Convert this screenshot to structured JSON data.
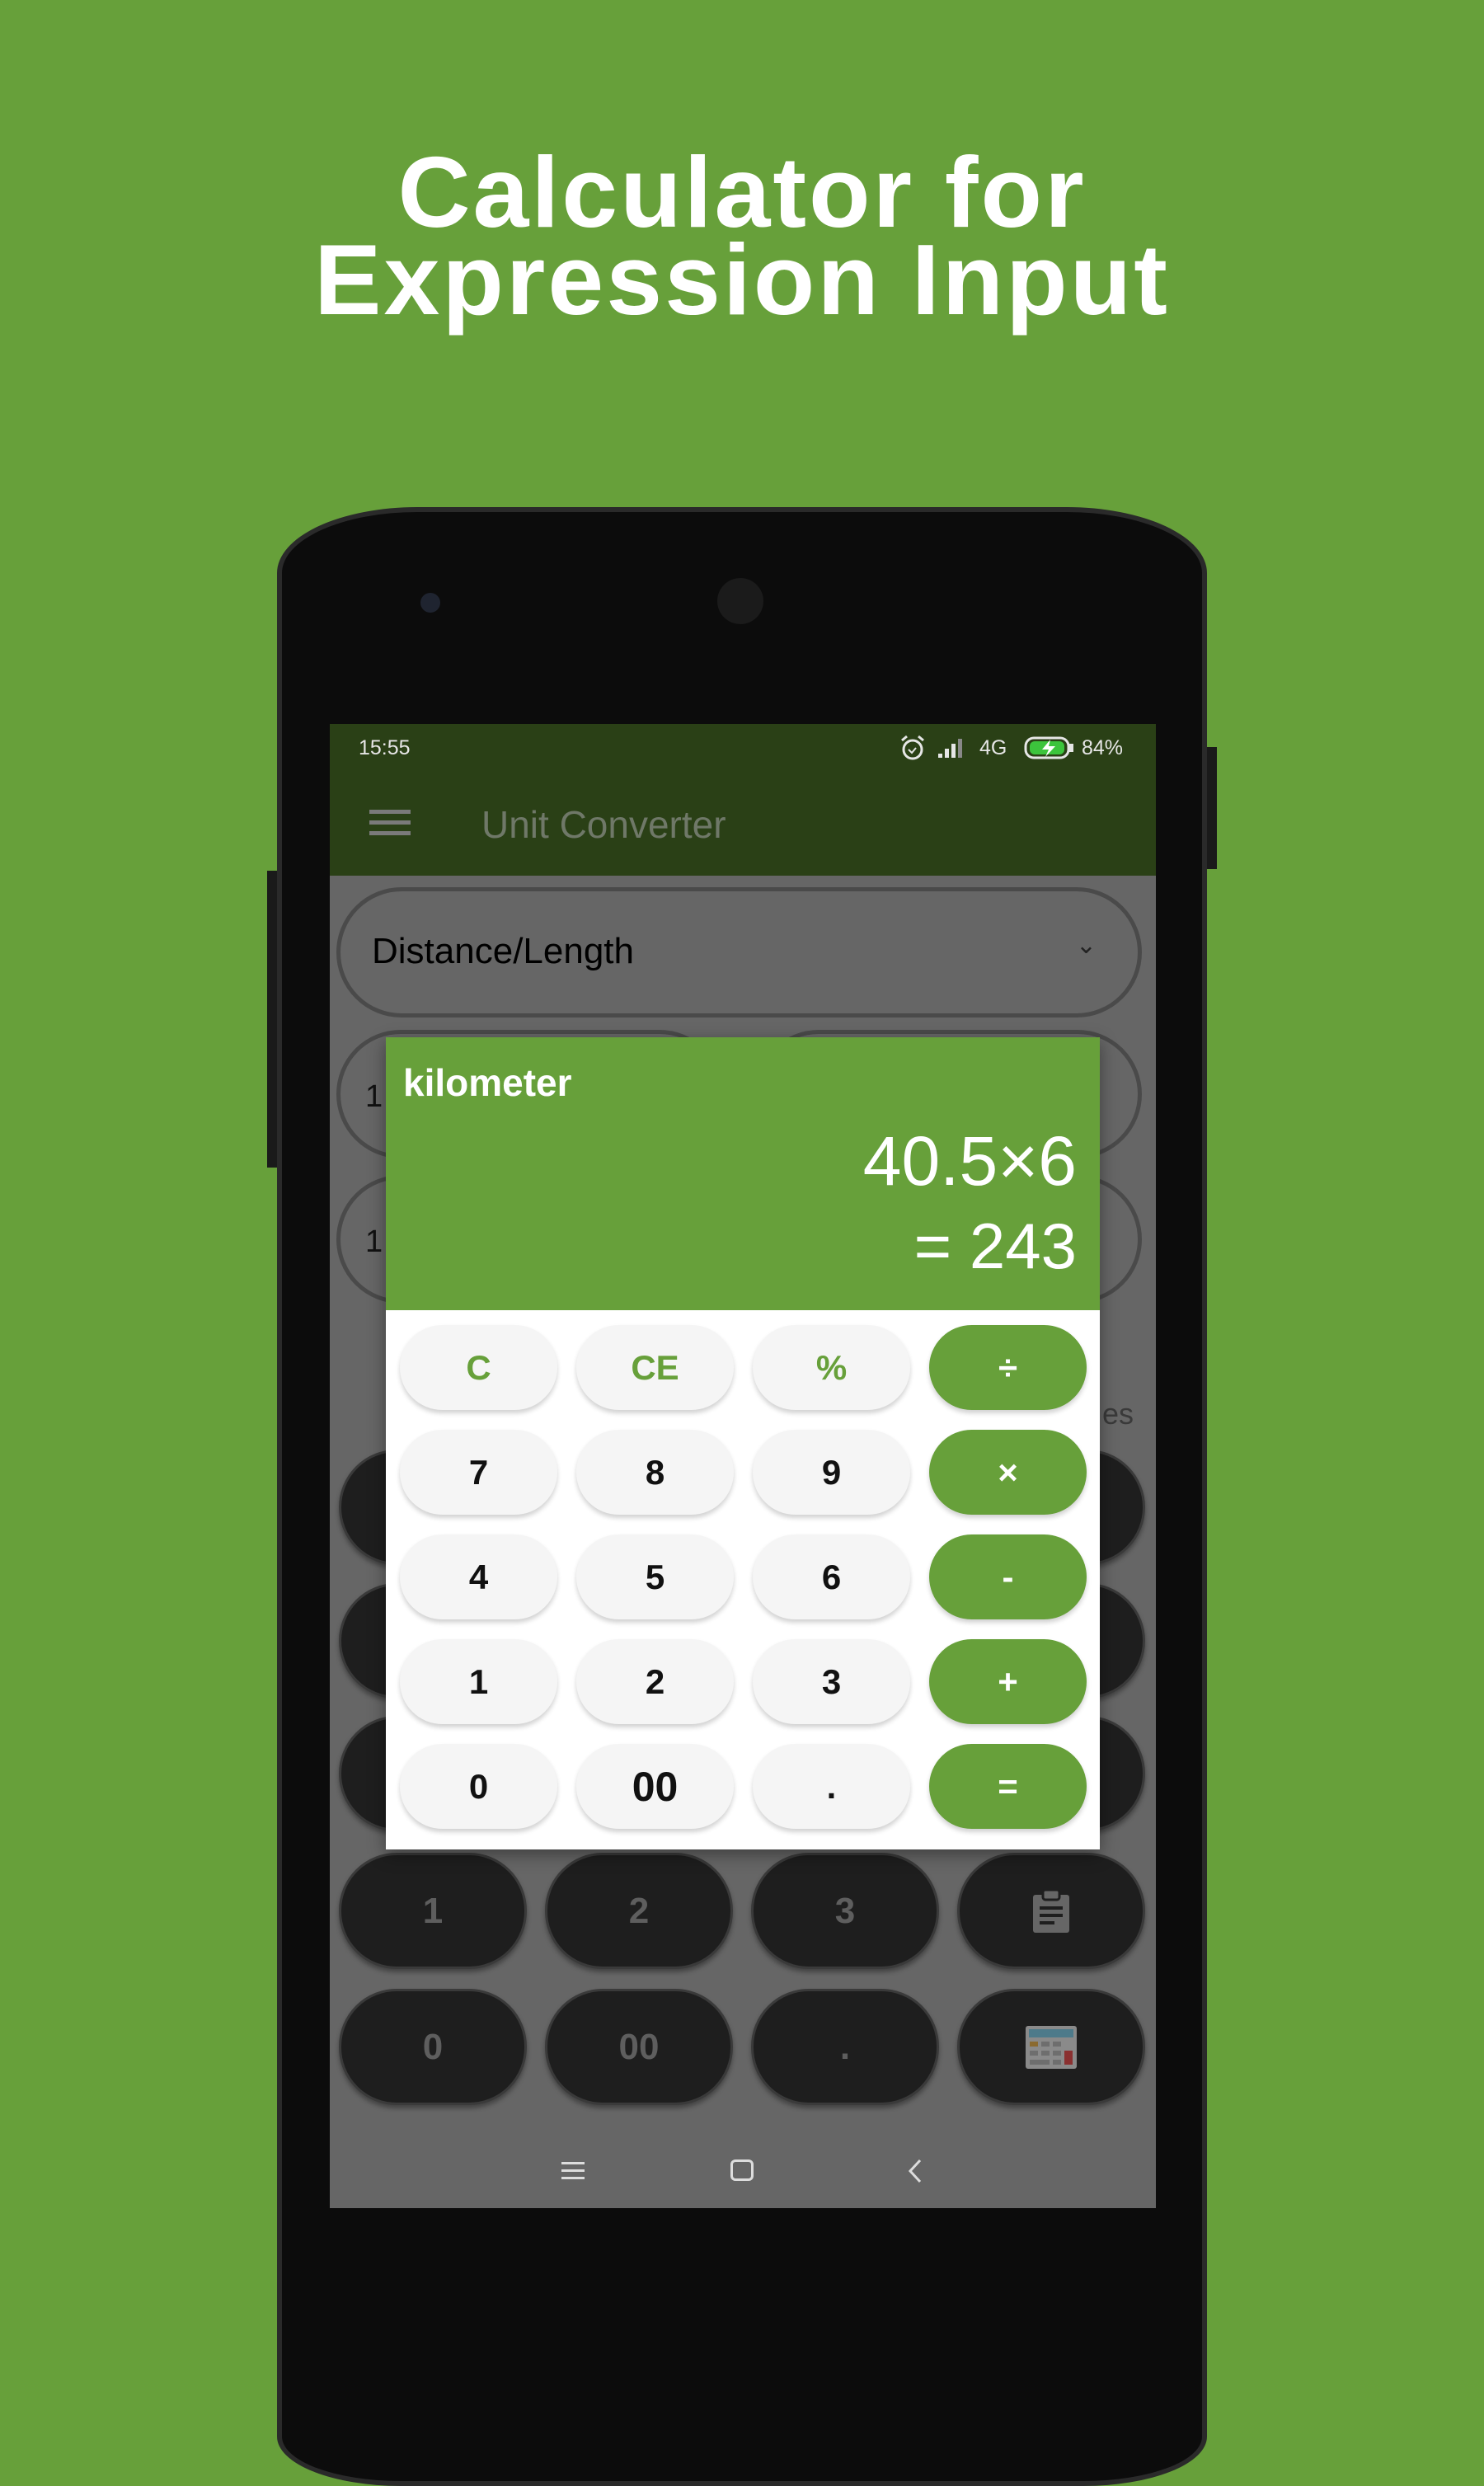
{
  "headline": {
    "line1": "Calculator for",
    "line2": "Expression Input"
  },
  "colors": {
    "background": "#67a03a",
    "appbar": "#2a4016",
    "accent": "#67a03a",
    "dim_overlay": "#666666"
  },
  "status_bar": {
    "time": "15:55",
    "network": "4G",
    "battery": "84%",
    "icons": [
      "alarm-icon",
      "signal-icon",
      "battery-charging-icon"
    ]
  },
  "app_bar": {
    "title": "Unit Converter",
    "menu_icon": "hamburger-icon"
  },
  "background_screen": {
    "category_dropdown": "Distance/Length",
    "from_value": "1",
    "to_value": "1",
    "partial_label": "es",
    "keypad_row4": [
      "1",
      "2",
      "3"
    ],
    "keypad_row5": [
      "0",
      "00",
      "."
    ],
    "clipboard_icon": "clipboard-icon",
    "calculator_icon": "calculator-icon"
  },
  "dialog": {
    "unit": "kilometer",
    "expression": "40.5×6",
    "result": "= 243",
    "keys": [
      [
        "C",
        "CE",
        "%",
        "÷"
      ],
      [
        "7",
        "8",
        "9",
        "×"
      ],
      [
        "4",
        "5",
        "6",
        "-"
      ],
      [
        "1",
        "2",
        "3",
        "+"
      ],
      [
        "0",
        "00",
        ".",
        "="
      ]
    ]
  },
  "nav_bar": {
    "icons": [
      "recents-icon",
      "home-icon",
      "back-icon"
    ]
  }
}
